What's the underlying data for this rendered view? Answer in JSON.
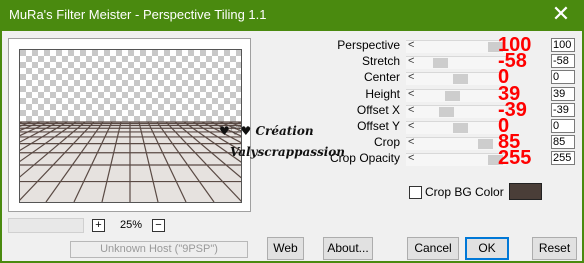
{
  "window": {
    "title": "MuRa's Filter Meister - Perspective Tiling 1.1",
    "close_glyph": "✕"
  },
  "preview": {
    "zoom": "25%",
    "zoom_in": "+",
    "zoom_out": "−"
  },
  "status": {
    "host": "Unknown Host (\"9PSP\")"
  },
  "watermark": {
    "line1": "♥♡♥ Création",
    "line2": "Valyscrappassion"
  },
  "params": [
    {
      "label": "Perspective",
      "value": "100",
      "big": "100",
      "thumb": 1.0
    },
    {
      "label": "Stretch",
      "value": "-58",
      "big": "-58",
      "thumb": 0.21
    },
    {
      "label": "Center",
      "value": "0",
      "big": "0",
      "thumb": 0.5
    },
    {
      "label": "Height",
      "value": "39",
      "big": "39",
      "thumb": 0.39
    },
    {
      "label": "Offset X",
      "value": "-39",
      "big": "-39",
      "thumb": 0.3
    },
    {
      "label": "Offset Y",
      "value": "0",
      "big": "0",
      "thumb": 0.5
    },
    {
      "label": "Crop",
      "value": "85",
      "big": "85",
      "thumb": 0.85
    },
    {
      "label": "Crop Opacity",
      "value": "255",
      "big": "255",
      "thumb": 1.0
    }
  ],
  "crop_bg": {
    "label": "Crop BG Color",
    "checked": false,
    "color": "#4a3e38"
  },
  "buttons": {
    "web": "Web",
    "about": "About...",
    "cancel": "Cancel",
    "ok": "OK",
    "reset": "Reset"
  },
  "colors": {
    "title_bar": "#4a8a0f",
    "accent_red": "#ff0000",
    "ok_border": "#0078d7"
  }
}
